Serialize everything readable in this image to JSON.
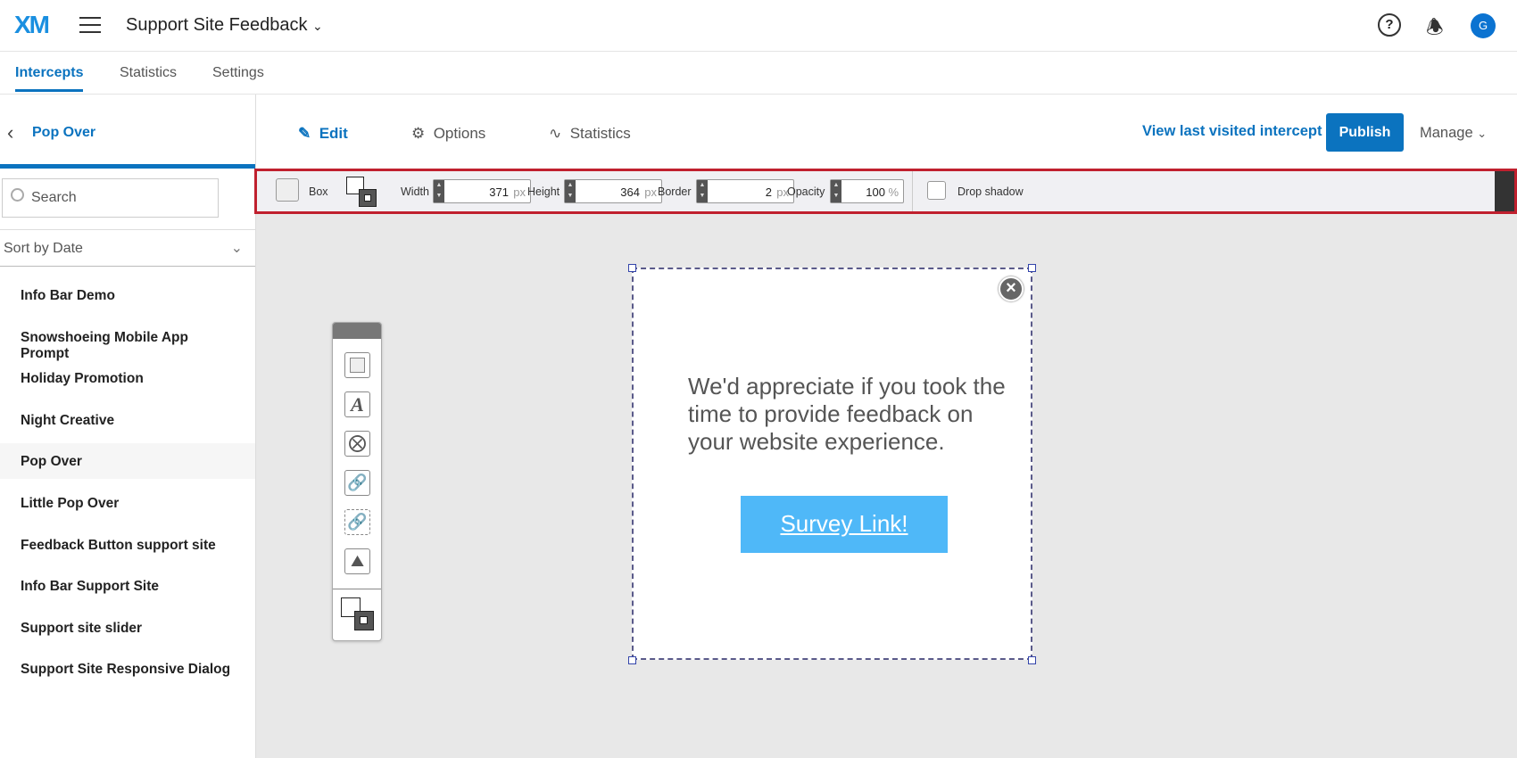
{
  "header": {
    "logo": "XM",
    "title": "Support Site Feedback",
    "help": "?",
    "avatar": "G"
  },
  "tabs": [
    "Intercepts",
    "Statistics",
    "Settings"
  ],
  "sidebar": {
    "title": "Pop Over",
    "search_placeholder": "Search",
    "sort": "Sort by Date",
    "items": [
      "Info Bar Demo",
      "Snowshoeing Mobile App Prompt",
      "Holiday Promotion",
      "Night Creative",
      "Pop Over",
      "Little Pop Over",
      "Feedback Button support site",
      "Info Bar Support Site",
      "Support site slider",
      "Support Site Responsive Dialog"
    ]
  },
  "subheader": {
    "edit": "Edit",
    "options": "Options",
    "statistics": "Statistics",
    "view_last": "View last visited intercept",
    "publish": "Publish",
    "manage": "Manage"
  },
  "toolbar": {
    "box": "Box",
    "width_label": "Width",
    "width": "371",
    "height_label": "Height",
    "height": "364",
    "border_label": "Border",
    "border": "2",
    "opacity_label": "Opacity",
    "opacity": "100",
    "px": "px",
    "pct": "%",
    "drop_shadow": "Drop shadow"
  },
  "popup": {
    "message": "We'd appreciate if you took the time to provide feedback on your website experience.",
    "link": "Survey Link!"
  }
}
